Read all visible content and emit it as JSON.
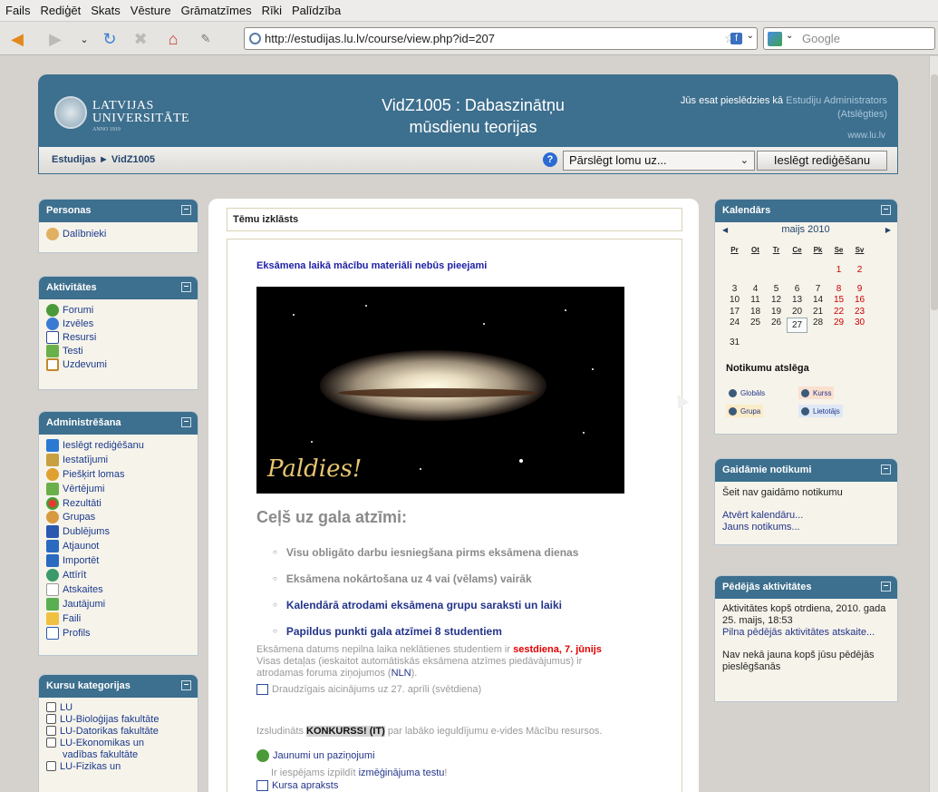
{
  "menu": [
    "Fails",
    "Rediģēt",
    "Skats",
    "Vēsture",
    "Grāmatzīmes",
    "Rīki",
    "Palīdzība"
  ],
  "browser": {
    "url": "http://estudijas.lu.lv/course/view.php?id=207",
    "search_placeholder": "Google"
  },
  "header": {
    "logo_line1": "LATVIJAS",
    "logo_line2": "UNIVERSITĀTE",
    "logo_sub": "ANNO 1919",
    "course_title": "VidZ1005 : Dabaszinātņu mūsdienu teorijas",
    "login_text": "Jūs esat pieslēdzies kā",
    "login_user": "Estudiju Administrators",
    "logout": "(Atslēgties)",
    "site": "www.lu.lv"
  },
  "navbar": {
    "breadcrumb": "Estudijas ► VidZ1005",
    "role_select": "Pārslēgt lomu uz...",
    "edit_button": "Ieslēgt rediģēšanu"
  },
  "blocks": {
    "persons": {
      "title": "Personas",
      "items": [
        "Dalībnieki"
      ]
    },
    "activities": {
      "title": "Aktivitātes",
      "items": [
        "Forumi",
        "Izvēles",
        "Resursi",
        "Testi",
        "Uzdevumi"
      ]
    },
    "admin": {
      "title": "Administrēšana",
      "items": [
        "Ieslēgt rediģēšanu",
        "Iestatījumi",
        "Piešķirt lomas",
        "Vērtējumi",
        "Rezultāti",
        "Grupas",
        "Dublējums",
        "Atjaunot",
        "Importēt",
        "Attīrīt",
        "Atskaites",
        "Jautājumi",
        "Faili",
        "Profils"
      ]
    },
    "categories": {
      "title": "Kursu kategorijas",
      "items": [
        "LU",
        "LU-Bioloģijas fakultāte",
        "LU-Datorikas fakultāte",
        "LU-Ekonomikas un",
        "vadības fakultāte",
        "LU-Fizikas un"
      ]
    }
  },
  "main": {
    "topics_title": "Tēmu izklāsts",
    "exam_note": "Eksāmena laikā mācību materiāli nebūs pieejami",
    "image_caption": "Paldies!",
    "grade_heading": "Ceļš uz gala atzīmi:",
    "grade_items": [
      "Visu obligāto darbu iesniegšana pirms eksāmena dienas",
      "Eksāmena nokārtošana uz 4 vai (vēlams) vairāk",
      "Kalendārā atrodami eksāmena grupu saraksti un laiki",
      "Papildus punkti gala atzīmei 8 studentiem"
    ],
    "info_1": "Eksāmena datums nepilna laika neklātienes studentiem ir ",
    "info_date": "sestdiena, 7. jūnijs",
    "info_2": "Visas detaļas (ieskaitot automātiskās eksāmena atzīmes piedāvājumus) ir",
    "info_3": "atrodamas foruma ziņojumos (",
    "info_link": "NLN",
    "info_4": ").",
    "invite": "Draudzīgais aicinājums uz 27. aprīli (svētdiena)",
    "promo_1": "Izsludināts ",
    "promo_hl": "KONKURSS! (IT)",
    "promo_2": " par labāko ieguldījumu e-vides Mācību resursos.",
    "news": "Jaunumi un paziņojumi",
    "quiz_1": "Ir iespējams izpildīt ",
    "quiz_link": "izmēģinājuma testu",
    "quiz_2": "!",
    "desc": "Kursa apraksts"
  },
  "calendar": {
    "title": "Kalendārs",
    "month": "maijs 2010",
    "days": [
      "Pr",
      "Ot",
      "Tr",
      "Ce",
      "Pk",
      "Se",
      "Sv"
    ],
    "weeks": [
      [
        "",
        "",
        "",
        "",
        "",
        "1",
        "2"
      ],
      [
        "3",
        "4",
        "5",
        "6",
        "7",
        "8",
        "9"
      ],
      [
        "10",
        "11",
        "12",
        "13",
        "14",
        "15",
        "16"
      ],
      [
        "17",
        "18",
        "19",
        "20",
        "21",
        "22",
        "23"
      ],
      [
        "24",
        "25",
        "26",
        "27",
        "28",
        "29",
        "30"
      ],
      [
        "31",
        "",
        "",
        "",
        "",
        "",
        ""
      ]
    ],
    "key_title": "Notikumu atslēga",
    "keys": [
      "Globāls",
      "Kurss",
      "Grupa",
      "Lietotājs"
    ]
  },
  "upcoming": {
    "title": "Gaidāmie notikumi",
    "none": "Šeit nav gaidāmo notikumu",
    "link1": "Atvērt kalendāru...",
    "link2": "Jauns notikums..."
  },
  "recent": {
    "title": "Pēdējās aktivitātes",
    "since": "Aktivitātes kopš otrdiena, 2010. gada 25. maijs, 18:53",
    "full": "Pilna pēdējās aktivitātes atskaite...",
    "none": "Nav nekā jauna kopš jūsu pēdējās pieslēgšanās"
  }
}
